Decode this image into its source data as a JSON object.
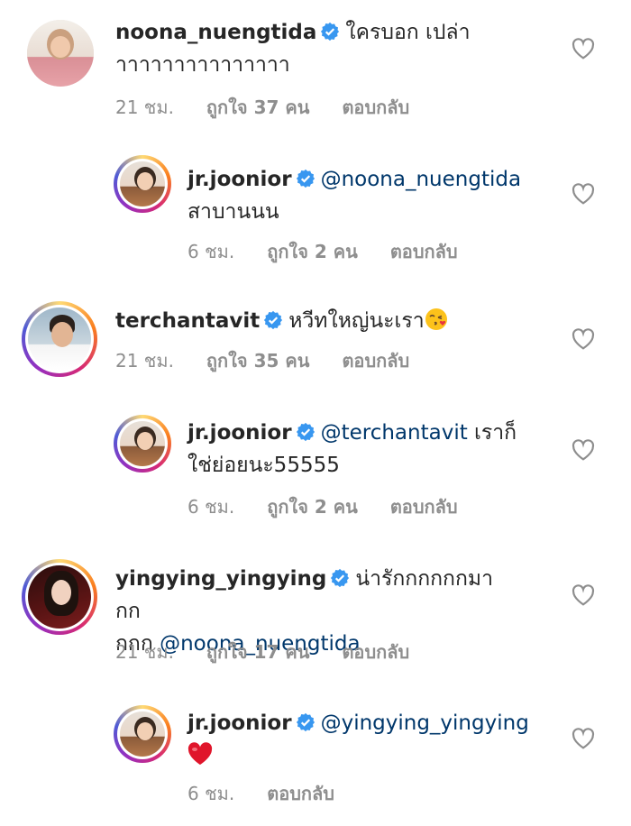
{
  "comments": [
    {
      "username": "noona_nuengtida",
      "text_line1": "ใครบอก เปล่า",
      "text_line2": "าาาาาาาาาาาาาาา",
      "time": "21 ชม.",
      "likes": "ถูกใจ 37 คน",
      "reply": "ตอบกลับ"
    },
    {
      "username": "jr.joonior",
      "mention": "@noona_nuengtida",
      "text_line2": "สาบานนน",
      "time": "6 ชม.",
      "likes": "ถูกใจ 2 คน",
      "reply": "ตอบกลับ"
    },
    {
      "username": "terchantavit",
      "text_line1": "หวีทใหญ่นะเรา",
      "emoji": "kissing-heart-emoji",
      "time": "21 ชม.",
      "likes": "ถูกใจ 35 คน",
      "reply": "ตอบกลับ"
    },
    {
      "username": "jr.joonior",
      "mention": "@terchantavit",
      "text_line1": " เราก็",
      "text_line2": "ใช่ย่อยนะ55555",
      "time": "6 ชม.",
      "likes": "ถูกใจ 2 คน",
      "reply": "ตอบกลับ"
    },
    {
      "username": "yingying_yingying",
      "text_line1": "น่ารักกกกกกมากก",
      "text_line2_prefix": "กกก ",
      "mention": "@noona_nuengtida",
      "time": "21 ชม.",
      "likes": "ถูกใจ 17 คน",
      "reply": "ตอบกลับ"
    },
    {
      "username": "jr.joonior",
      "mention": "@yingying_yingying",
      "emoji": "red-heart-emoji",
      "time": "6 ชม.",
      "reply": "ตอบกลับ"
    }
  ],
  "colors": {
    "text": "#262626",
    "secondary": "#8e8e8e",
    "mention": "#00376b",
    "verified": "#3897f0"
  }
}
